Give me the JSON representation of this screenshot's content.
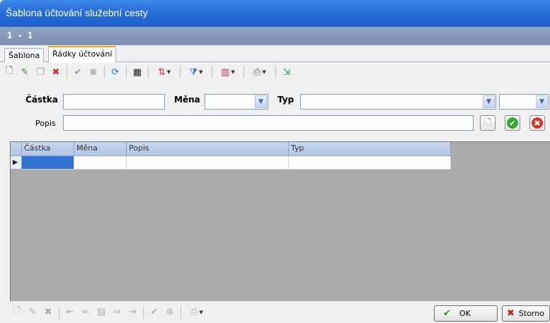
{
  "window": {
    "title": "Šablona účtování služební cesty"
  },
  "record_bar": {
    "text": "1 - 1"
  },
  "tabs": [
    {
      "label": "Šablona",
      "active": false
    },
    {
      "label": "Řádky účtování",
      "active": true
    }
  ],
  "form": {
    "amount_label": "Částka",
    "amount_value": "",
    "currency_label": "Měna",
    "currency_value": "",
    "type_label": "Typ",
    "type_value": "",
    "type2_value": "",
    "description_label": "Popis",
    "description_value": ""
  },
  "grid": {
    "columns": [
      "Částka",
      "Měna",
      "Popis",
      "Typ"
    ],
    "rows": [
      [
        "",
        "",
        "",
        ""
      ]
    ]
  },
  "buttons": {
    "ok": "OK",
    "cancel": "Storno"
  },
  "icons": {
    "toolbar": [
      "new-icon",
      "edit-icon",
      "copy-icon",
      "delete-icon",
      "confirm-icon",
      "discard-icon",
      "refresh-icon",
      "find-icon",
      "sort-icon",
      "filter-icon",
      "columns-icon",
      "print-icon",
      "export-icon"
    ],
    "nav": [
      "new-icon",
      "edit-icon",
      "delete-icon",
      "first-icon",
      "prev-icon",
      "record-icon",
      "next-icon",
      "last-icon",
      "confirm-icon",
      "discard-icon",
      "print-icon"
    ]
  }
}
